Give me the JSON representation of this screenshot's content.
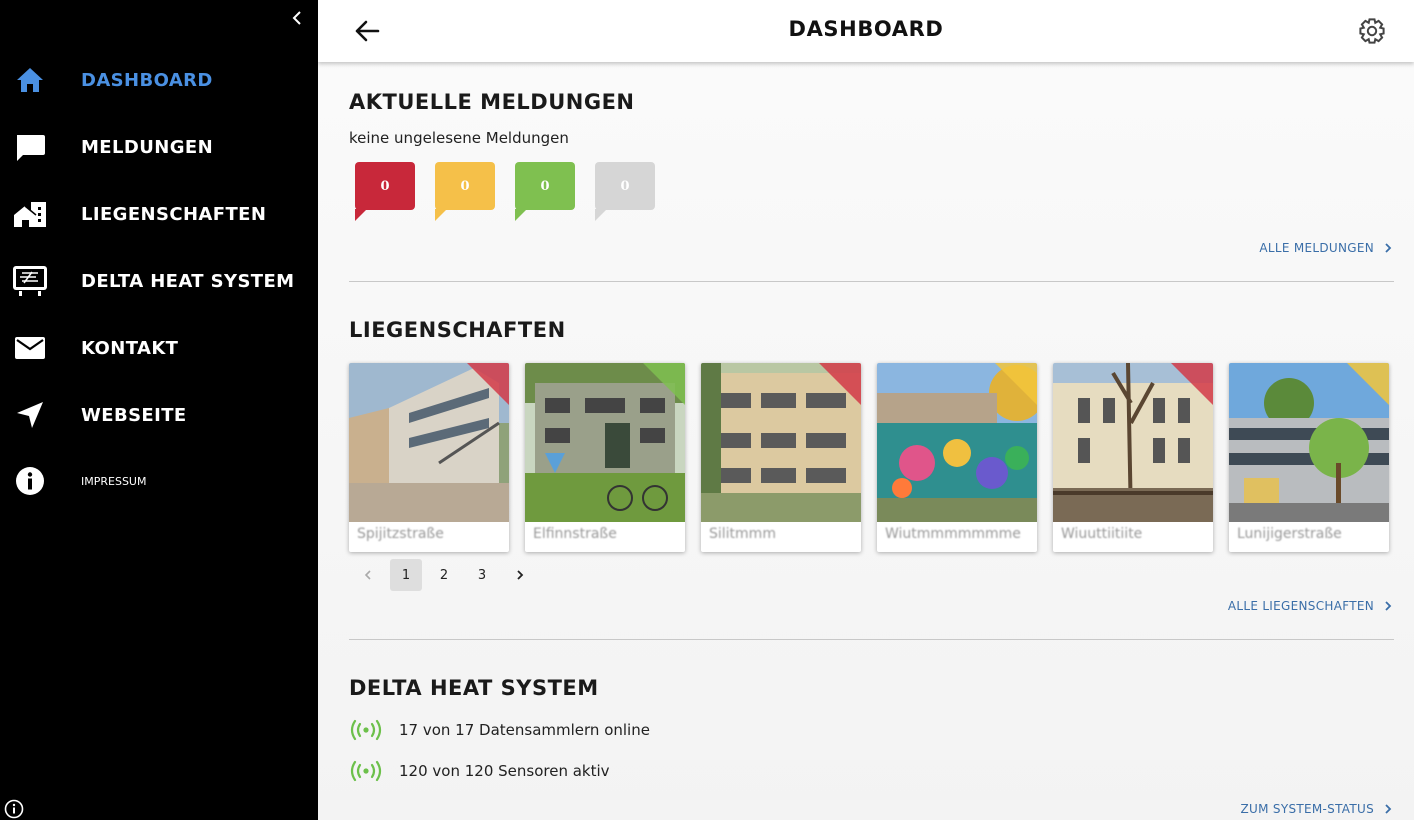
{
  "sidebar": {
    "items": [
      {
        "label": "DASHBOARD",
        "icon": "home-icon"
      },
      {
        "label": "MELDUNGEN",
        "icon": "chat-bubble-icon"
      },
      {
        "label": "LIEGENSCHAFTEN",
        "icon": "buildings-icon"
      },
      {
        "label": "DELTA HEAT SYSTEM",
        "icon": "monitor-icon"
      },
      {
        "label": "KONTAKT",
        "icon": "mail-icon"
      },
      {
        "label": "WEBSEITE",
        "icon": "navigation-arrow-icon"
      },
      {
        "label": "IMPRESSUM",
        "icon": "info-icon"
      }
    ],
    "active_color": "#4a90e2"
  },
  "header": {
    "title": "DASHBOARD"
  },
  "messages": {
    "title": "AKTUELLE MELDUNGEN",
    "status": "keine ungelesene Meldungen",
    "counts": [
      {
        "value": "0",
        "color": "#c8283a"
      },
      {
        "value": "0",
        "color": "#f5c049"
      },
      {
        "value": "0",
        "color": "#7fc050"
      },
      {
        "value": "0",
        "color": "#d6d6d6"
      }
    ],
    "link": "ALLE MELDUNGEN"
  },
  "properties": {
    "title": "LIEGENSCHAFTEN",
    "cards": [
      {
        "name": "Spijitzstraße",
        "status_color": "#d23a48"
      },
      {
        "name": "Elfinnstraße",
        "status_color": "#7fc050"
      },
      {
        "name": "Silitmmm",
        "status_color": "#d23a48"
      },
      {
        "name": "Wiutmmmmmmme",
        "status_color": "#f2c53c"
      },
      {
        "name": "Wiuuttiitiite",
        "status_color": "#d23a48"
      },
      {
        "name": "Lunijigerstraße",
        "status_color": "#f2c53c"
      }
    ],
    "pagination": [
      "1",
      "2",
      "3"
    ],
    "current_page": "1",
    "link": "ALLE LIEGENSCHAFTEN"
  },
  "system": {
    "title": "DELTA HEAT SYSTEM",
    "stats": [
      {
        "text": "17 von 17 Datensammlern online",
        "icon": "signal-broadcast-icon"
      },
      {
        "text": "120 von 120 Sensoren aktiv",
        "icon": "signal-broadcast-icon"
      }
    ],
    "online_color": "#6cc04a",
    "link": "ZUM SYSTEM-STATUS"
  }
}
